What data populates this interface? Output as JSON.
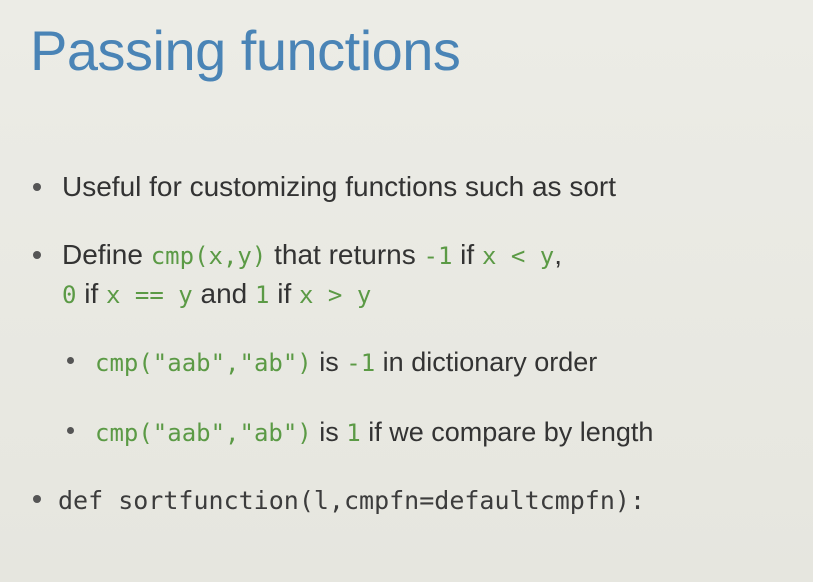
{
  "title": "Passing functions",
  "bullets": {
    "b1": {
      "text": "Useful for customizing functions such as sort"
    },
    "b2": {
      "t1": "Define ",
      "c1": "cmp(x,y)",
      "t2": " that returns ",
      "c2": "-1",
      "t3": " if ",
      "c3": "x < y",
      "t4": ",",
      "c4": "0",
      "t5": " if ",
      "c5": "x == y",
      "t6": " and ",
      "c6": "1",
      "t7": " if ",
      "c7": "x > y"
    },
    "b3": {
      "c1": "cmp(\"aab\",\"ab\")",
      "t1": " is ",
      "c2": "-1",
      "t2": " in dictionary order"
    },
    "b4": {
      "c1": "cmp(\"aab\",\"ab\")",
      "t1": " is ",
      "c2": "1",
      "t2": " if we compare by length"
    },
    "b5": {
      "code": "def sortfunction(l,cmpfn=defaultcmpfn):"
    }
  }
}
